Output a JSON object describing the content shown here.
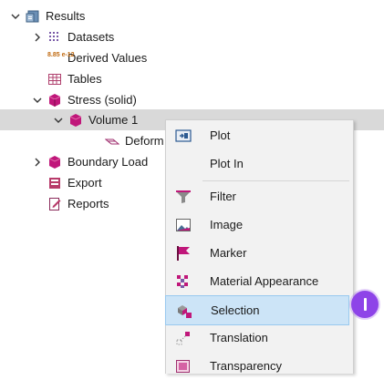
{
  "tree": {
    "results": "Results",
    "datasets": "Datasets",
    "derived_values": "Derived Values",
    "derived_icon_text": "8.85 e-12",
    "tables": "Tables",
    "stress": "Stress (solid)",
    "volume1": "Volume 1",
    "deform": "Deform",
    "boundary": "Boundary Load",
    "export": "Export",
    "reports": "Reports"
  },
  "menu": {
    "items": [
      {
        "label": "Plot",
        "icon": "plot-icon"
      },
      {
        "label": "Plot In",
        "icon": ""
      },
      {
        "label": "Filter",
        "icon": "filter-icon"
      },
      {
        "label": "Image",
        "icon": "image-icon"
      },
      {
        "label": "Marker",
        "icon": "flag-icon"
      },
      {
        "label": "Material Appearance",
        "icon": "material-appearance-icon"
      },
      {
        "label": "Selection",
        "icon": "selection-icon"
      },
      {
        "label": "Translation",
        "icon": "translation-icon"
      },
      {
        "label": "Transparency",
        "icon": "transparency-icon"
      }
    ],
    "highlighted": "Selection"
  },
  "colors": {
    "accent": "#8e44e8",
    "highlight_bg": "#cce4f7",
    "selected_row_bg": "#d9d9d9",
    "stress_icon": "#c0177a"
  }
}
